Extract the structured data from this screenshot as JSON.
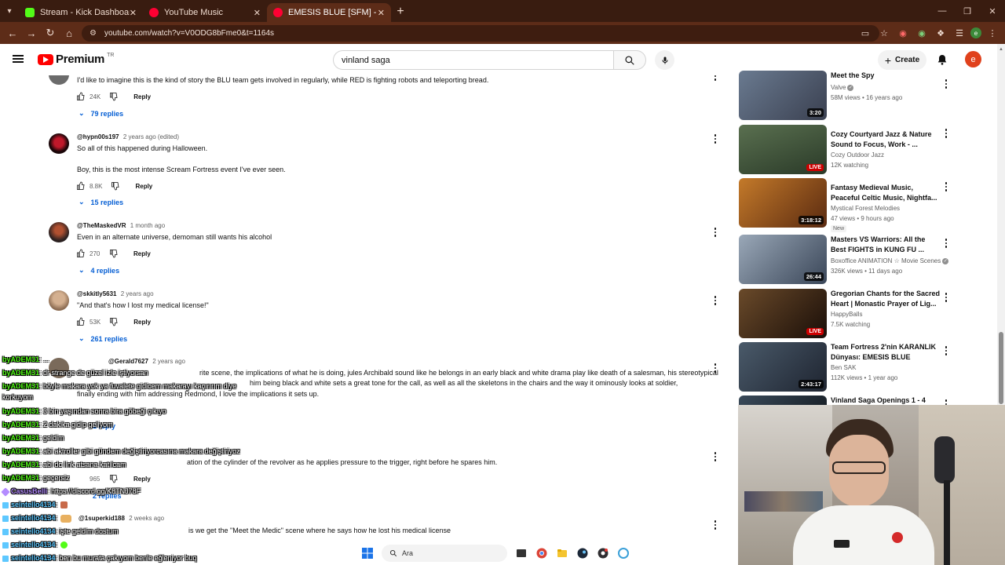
{
  "browser": {
    "tabs": [
      {
        "label": "Stream - Kick Dashboard",
        "color": "#53fc18",
        "active": false
      },
      {
        "label": "YouTube Music",
        "color": "#ff0033",
        "active": false
      },
      {
        "label": "EMESIS BLUE [SFM] - YouTube",
        "color": "#ff0033",
        "active": true
      }
    ],
    "url": "youtube.com/watch?v=V0ODG8bFme0&t=1164s"
  },
  "masthead": {
    "logo_text": "Premium",
    "region": "TR",
    "search_value": "vinland saga",
    "create_label": "Create",
    "avatar_letter": "e"
  },
  "comments": [
    {
      "author": "",
      "time": "",
      "text": [
        "I'd like to imagine this is the kind of story the BLU team gets involved in regularly, while RED is fighting robots and teleporting bread."
      ],
      "likes": "24K",
      "reply_label": "Reply",
      "replies": "79 replies"
    },
    {
      "author": "@hypn00s197",
      "time": "2 years ago (edited)",
      "text": [
        "So all of this happened during Halloween.",
        "",
        "Boy, this is the most intense Scream Fortress event I've ever seen."
      ],
      "likes": "8.8K",
      "reply_label": "Reply",
      "replies": "15 replies"
    },
    {
      "author": "@TheMaskedVR",
      "time": "1 month ago",
      "text": [
        "Even in an alternate universe, demoman still wants his alcohol"
      ],
      "likes": "270",
      "reply_label": "Reply",
      "replies": "4 replies"
    },
    {
      "author": "@skkitly5631",
      "time": "2 years ago",
      "text": [
        "\"And that's how I lost my medical license!\""
      ],
      "likes": "53K",
      "reply_label": "Reply",
      "replies": "261 replies"
    },
    {
      "author": "@Gerald7627",
      "time": "2 years ago",
      "text": [
        "rite scene, the implications of what he is doing, jules Archibald sound like he belongs in an early black and white drama play like death of a salesman, his stereotypical",
        "him being black and white sets a great tone for the call, as well as all the skeletons in the chairs and the way it ominously looks at soldier,",
        "finally ending with him addressing Redmond, I love the implications it sets up."
      ],
      "likes": "",
      "reply_label": "",
      "replies": "1 reply"
    },
    {
      "author": "",
      "time": "",
      "text": [
        "ation of the cylinder of the revolver as he applies pressure to the trigger, right before he spares him."
      ],
      "likes": "965",
      "reply_label": "Reply",
      "replies": "2 replies"
    },
    {
      "author": "@1superkid188",
      "time": "2 weeks ago",
      "text": [
        "is we get the \"Meet the Medic\" scene where he says how he lost his medical license"
      ],
      "likes": "",
      "reply_label": "",
      "replies": ""
    }
  ],
  "sidebar": [
    {
      "title": "Meet the Spy",
      "channel": "Valve",
      "verified": true,
      "stats": "58M views • 16 years ago",
      "duration": "3:20",
      "live": false,
      "new_badge": "",
      "thumb": "#4a5a70"
    },
    {
      "title": "Cozy Courtyard Jazz & Nature Sound to Focus, Work - ...",
      "channel": "Cozy Outdoor Jazz",
      "verified": false,
      "stats": "12K watching",
      "duration": "",
      "live": true,
      "live_label": "LIVE",
      "new_badge": "",
      "thumb": "#3f5a3a"
    },
    {
      "title": "Fantasy Medieval Music, Peaceful Celtic Music, Nightfa...",
      "channel": "Mystical Forest Melodies",
      "verified": false,
      "stats": "47 views • 9 hours ago",
      "duration": "3:18:12",
      "live": false,
      "new_badge": "New",
      "thumb": "#8a4a1a"
    },
    {
      "title": "Masters VS Warriors: All the Best FIGHTS in KUNG FU ...",
      "channel": "Boxoffice ANIMATION ☆ Movie Scenes",
      "verified": true,
      "stats": "326K views • 11 days ago",
      "duration": "26:44",
      "live": false,
      "new_badge": "",
      "thumb": "#5a6a80"
    },
    {
      "title": "Gregorian Chants for the Sacred Heart | Monastic Prayer of Lig...",
      "channel": "HappyBalls",
      "verified": false,
      "stats": "7.5K watching",
      "duration": "",
      "live": true,
      "live_label": "LIVE",
      "new_badge": "",
      "thumb": "#3a2416"
    },
    {
      "title": "Team Fortress 2'nin KARANLIK Dünyası: EMESIS BLUE",
      "channel": "Ben SAK",
      "verified": false,
      "stats": "112K views • 1 year ago",
      "duration": "2:43:17",
      "live": false,
      "new_badge": "",
      "thumb": "#3a3e4a"
    },
    {
      "title": "Vinland Saga Openings 1 - 4",
      "channel": "",
      "verified": false,
      "stats": "",
      "duration": "",
      "live": false,
      "new_badge": "",
      "thumb": "#2a3a4a"
    }
  ],
  "chat": [
    {
      "user": "byADEM31",
      "text": ": ...",
      "color": "#53fc18"
    },
    {
      "user": "byADEM31",
      "text": ": dr strange de güzel izle iştiyorsan",
      "color": "#53fc18"
    },
    {
      "user": "byADEM31",
      "text": ": böyle makara yok ya fuvalete gidicem makarayı kaçırırım diye",
      "color": "#53fc18"
    },
    {
      "user": "",
      "text": "korkuyom",
      "color": "#53fc18"
    },
    {
      "user": "byADEM31",
      "text": ": 3 bin yaşından sonra bira göbeği çıkıyo",
      "color": "#53fc18"
    },
    {
      "user": "byADEM31",
      "text": ": 2 dakika gidip geliyom",
      "color": "#53fc18"
    },
    {
      "user": "byADEM31",
      "text": ": geldim",
      "color": "#53fc18"
    },
    {
      "user": "byADEM31",
      "text": ": abi aktroller gibi gündem değiştiriyorcasına makara değiştiriyoz",
      "color": "#53fc18"
    },
    {
      "user": "byADEM31",
      "text": ": abi dc link atsana katılcam",
      "color": "#53fc18"
    },
    {
      "user": "byADEM31",
      "text": ": geçersiz",
      "color": "#53fc18"
    },
    {
      "user": "CasusBelli",
      "text": ": https://discord.gg/K8TNJ78F",
      "color": "#b48cff"
    },
    {
      "user": "seintello4134",
      "text": ":",
      "color": "#5ec8ff"
    },
    {
      "user": "seintello4134",
      "text": ":",
      "color": "#5ec8ff"
    },
    {
      "user": "seintello4134",
      "text": ": işte geldim dostum",
      "color": "#5ec8ff"
    },
    {
      "user": "seintello4134",
      "text": ":",
      "color": "#5ec8ff"
    },
    {
      "user": "seintello4134",
      "text": ": ben bu murata çakıyom benle eğleniyor buq",
      "color": "#5ec8ff"
    }
  ],
  "taskbar": {
    "search_placeholder": "Ara"
  },
  "colors": {
    "accent_blue": "#065fd4",
    "brand_red": "#ff0000",
    "browser_frame": "#5d2c18"
  }
}
